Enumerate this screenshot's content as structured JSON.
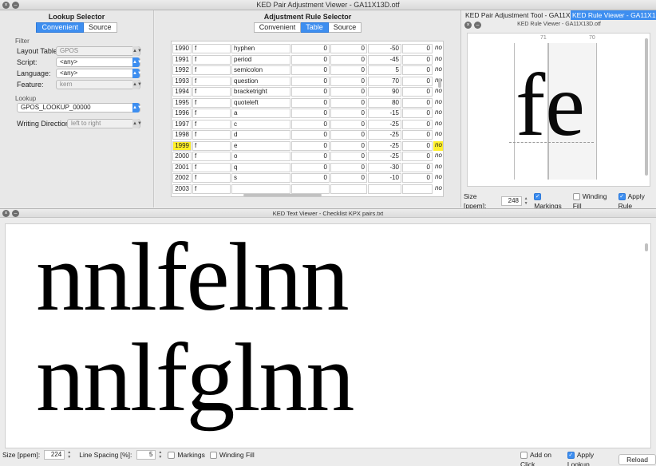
{
  "window": {
    "title": "KED Pair Adjustment Viewer - GA11X13D.otf"
  },
  "lookup_selector": {
    "title": "Lookup Selector",
    "tabs": [
      {
        "label": "Convenient",
        "active": true
      },
      {
        "label": "Source",
        "active": false
      }
    ],
    "filter_label": "Filter",
    "layout_table_label": "Layout Table:",
    "layout_table_value": "GPOS",
    "script_label": "Script:",
    "script_value": "<any>",
    "language_label": "Language:",
    "language_value": "<any>",
    "feature_label": "Feature:",
    "feature_value": "kern",
    "lookup_label": "Lookup",
    "lookup_value": "GPOS_LOOKUP_00000",
    "writing_direction_label": "Writing Direction:",
    "writing_direction_value": "left to right"
  },
  "rule_selector": {
    "title": "Adjustment Rule Selector",
    "tabs": [
      {
        "label": "Convenient",
        "active": false
      },
      {
        "label": "Table",
        "active": true
      },
      {
        "label": "Source",
        "active": false
      }
    ],
    "rows": [
      {
        "id": "1990",
        "g1": "f",
        "g2": "hyphen",
        "a": "0",
        "b": "0",
        "c": "-50",
        "d": "0",
        "note": "no furt."
      },
      {
        "id": "1991",
        "g1": "f",
        "g2": "period",
        "a": "0",
        "b": "0",
        "c": "-45",
        "d": "0",
        "note": "no furt."
      },
      {
        "id": "1992",
        "g1": "f",
        "g2": "semicolon",
        "a": "0",
        "b": "0",
        "c": "5",
        "d": "0",
        "note": "no furt."
      },
      {
        "id": "1993",
        "g1": "f",
        "g2": "question",
        "a": "0",
        "b": "0",
        "c": "70",
        "d": "0",
        "note": "no furt."
      },
      {
        "id": "1994",
        "g1": "f",
        "g2": "bracketright",
        "a": "0",
        "b": "0",
        "c": "90",
        "d": "0",
        "note": "no furt."
      },
      {
        "id": "1995",
        "g1": "f",
        "g2": "quoteleft",
        "a": "0",
        "b": "0",
        "c": "80",
        "d": "0",
        "note": "no furt."
      },
      {
        "id": "1996",
        "g1": "f",
        "g2": "a",
        "a": "0",
        "b": "0",
        "c": "-15",
        "d": "0",
        "note": "no furt."
      },
      {
        "id": "1997",
        "g1": "f",
        "g2": "c",
        "a": "0",
        "b": "0",
        "c": "-25",
        "d": "0",
        "note": "no furt."
      },
      {
        "id": "1998",
        "g1": "f",
        "g2": "d",
        "a": "0",
        "b": "0",
        "c": "-25",
        "d": "0",
        "note": "no furt."
      },
      {
        "id": "1999",
        "g1": "f",
        "g2": "e",
        "a": "0",
        "b": "0",
        "c": "-25",
        "d": "0",
        "note": "no furt.",
        "selected": true
      },
      {
        "id": "2000",
        "g1": "f",
        "g2": "o",
        "a": "0",
        "b": "0",
        "c": "-25",
        "d": "0",
        "note": "no furt."
      },
      {
        "id": "2001",
        "g1": "f",
        "g2": "q",
        "a": "0",
        "b": "0",
        "c": "-30",
        "d": "0",
        "note": "no furt."
      },
      {
        "id": "2002",
        "g1": "f",
        "g2": "s",
        "a": "0",
        "b": "0",
        "c": "-10",
        "d": "0",
        "note": "no furt."
      },
      {
        "id": "2003",
        "g1": "f",
        "g2": "",
        "a": "",
        "b": "",
        "c": "",
        "d": "",
        "note": "no furt."
      }
    ]
  },
  "rule_viewer": {
    "tabs": [
      {
        "label": "KED Pair Adjustment Tool - GA11X1...",
        "active": false
      },
      {
        "label": "KED Rule Viewer - GA11X1...",
        "active": true
      }
    ],
    "subtitle": "KED Rule Viewer - GA11X13D.otf",
    "adv1": "71",
    "adv2": "70",
    "glyphs": "fe",
    "size_label": "Size [ppem]:",
    "size_value": "248",
    "markings_label": "Markings",
    "markings_checked": true,
    "winding_label": "Winding Fill",
    "winding_checked": false,
    "apply_rule_label": "Apply Rule",
    "apply_rule_checked": true
  },
  "text_viewer": {
    "title": "KED Text Viewer - Checklist KPX pairs.txt",
    "line1": "nnlfelnn",
    "line2": "nnlfglnn",
    "size_label": "Size [ppem]:",
    "size_value": "224",
    "line_spacing_label": "Line Spacing [%]:",
    "line_spacing_value": "5",
    "markings_label": "Markings",
    "markings_checked": false,
    "winding_label": "Winding Fill",
    "winding_checked": false,
    "add_on_click_label": "Add on Click",
    "add_on_click_checked": false,
    "apply_lookup_label": "Apply Lookup",
    "apply_lookup_checked": true,
    "reload_label": "Reload"
  },
  "colors": {
    "accent": "#3d8ef0",
    "highlight": "#fff02b"
  }
}
